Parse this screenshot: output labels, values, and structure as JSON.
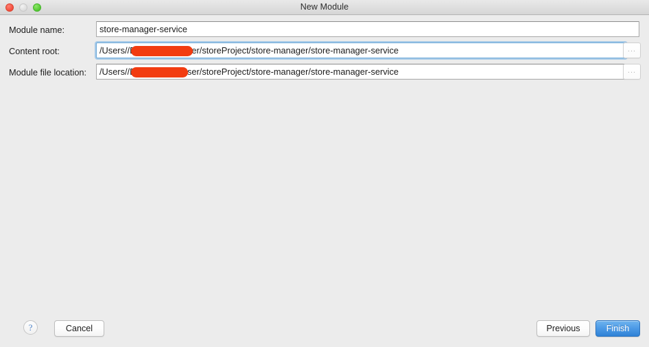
{
  "window": {
    "title": "New Module",
    "traffic_lights": [
      {
        "name": "close",
        "color": "#f24c3d"
      },
      {
        "name": "minimize",
        "color": "#dcdcdc"
      },
      {
        "name": "maximize",
        "color": "#54c832"
      }
    ]
  },
  "form": {
    "rows": [
      {
        "label": "Module name:",
        "value": "store-manager-service",
        "placeholder": "",
        "focused": false,
        "has_browse": false,
        "redacted": false
      },
      {
        "label": "Content root:",
        "value": "/Users/████████/Desktop/ideaUser/storeProject/store-manager/store-manager-service",
        "path_prefix": "/Users/",
        "path_suffix": "/Desktop/ideaUser/storeProject/store-manager/store-manager-service",
        "placeholder": "",
        "focused": true,
        "has_browse": true,
        "browse_label": "...",
        "redacted": true
      },
      {
        "label": "Module file location:",
        "value": "/Users/████████/Desktop/ideaUser/storeProject/store-manager/store-manager-service",
        "path_prefix": "/Users/",
        "path_suffix": "/Desktop/ideaUser/storeProject/store-manager/store-manager-service",
        "placeholder": "",
        "focused": false,
        "has_browse": true,
        "browse_label": "...",
        "redacted": true
      }
    ]
  },
  "footer": {
    "help_label": "?",
    "cancel_label": "Cancel",
    "previous_label": "Previous",
    "finish_label": "Finish"
  },
  "colors": {
    "dialog_background": "#ececec",
    "titlebar": "#dfdfdf",
    "focus_ring": "#76b2e6",
    "default_button": "#2f82d6",
    "redaction": "#f23c10",
    "text": "#1c1c1c"
  }
}
